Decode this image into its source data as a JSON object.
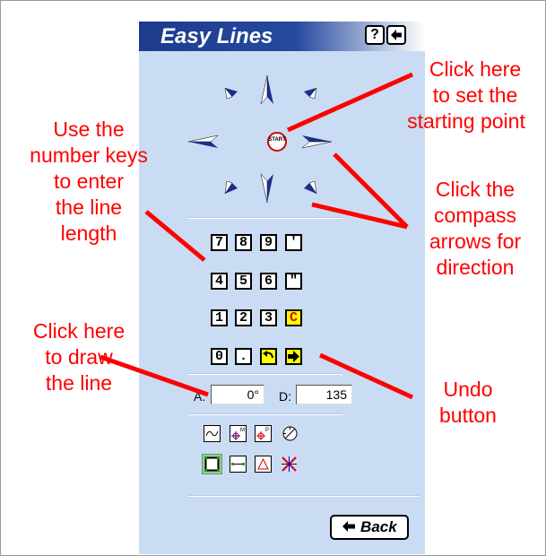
{
  "panel": {
    "title": "Easy Lines",
    "help_icon_label": "?",
    "start_label": "START",
    "keypad": [
      [
        "7",
        "8",
        "9",
        "'"
      ],
      [
        "4",
        "5",
        "6",
        "\""
      ],
      [
        "1",
        "2",
        "3",
        "C"
      ],
      [
        "0",
        ".",
        "undo",
        "enter"
      ]
    ],
    "angle_label": "A:",
    "angle_value": "0°",
    "distance_label": "D:",
    "distance_value": "135",
    "back_label": "Back"
  },
  "annotations": {
    "start_point": "Click here\nto set the\nstarting point",
    "number_keys": "Use the\nnumber keys\nto enter\nthe line\nlength",
    "compass": "Click the\ncompass\narrows for\ndirection",
    "draw_line": "Click here\nto draw\nthe line",
    "undo": "Undo\nbutton"
  },
  "colors": {
    "panel_bg": "#c9dcf3",
    "title_bar": "#26499f",
    "annotation": "#ff0000",
    "arrow_fill": "#1a2f8f",
    "key_highlight": "#ffff00"
  }
}
